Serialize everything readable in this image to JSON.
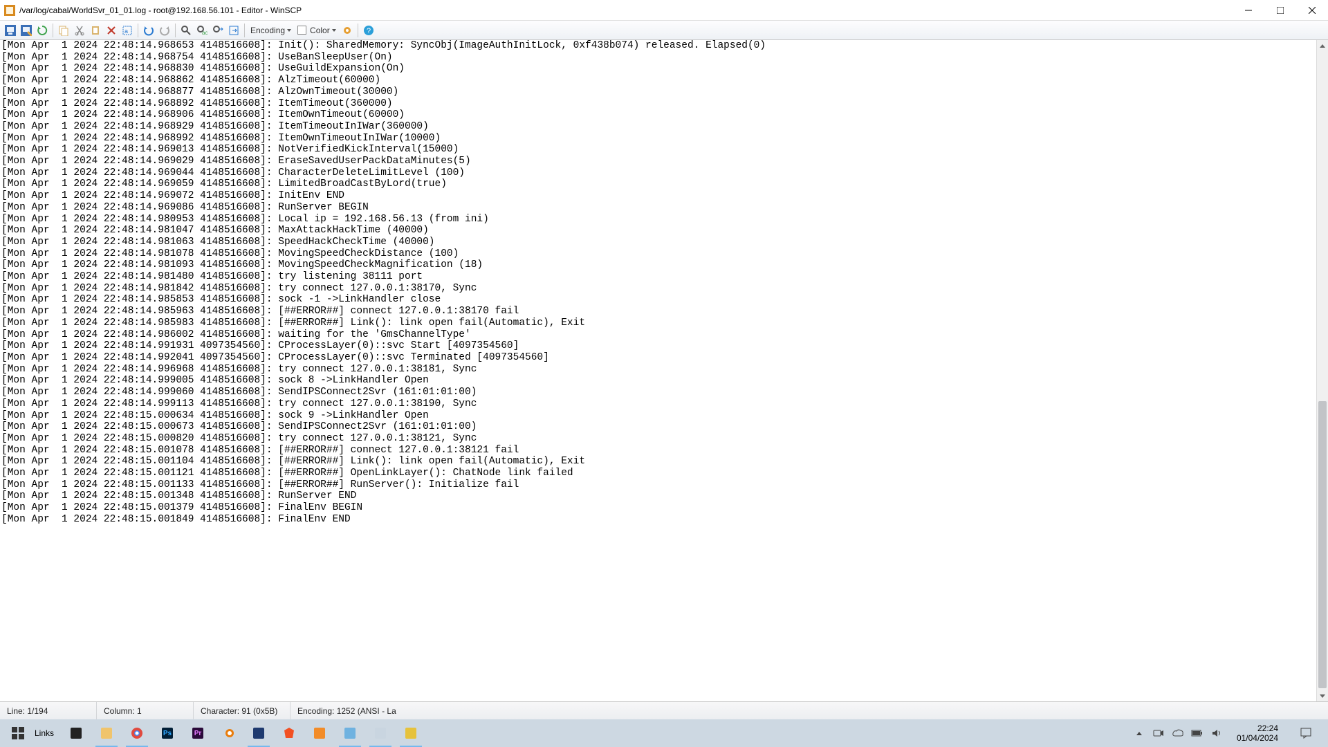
{
  "window": {
    "title": "/var/log/cabal/WorldSvr_01_01.log - root@192.168.56.101 - Editor - WinSCP"
  },
  "toolbar": {
    "encoding_label": "Encoding",
    "color_label": "Color"
  },
  "status": {
    "line": "Line: 1/194",
    "column": "Column: 1",
    "character": "Character: 91 (0x5B)",
    "encoding": "Encoding: 1252  (ANSI - La"
  },
  "log_lines": [
    "[Mon Apr  1 2024 22:48:14.968653 4148516608]: Init(): SharedMemory: SyncObj(ImageAuthInitLock, 0xf438b074) released. Elapsed(0)",
    "[Mon Apr  1 2024 22:48:14.968754 4148516608]: UseBanSleepUser(On)",
    "[Mon Apr  1 2024 22:48:14.968830 4148516608]: UseGuildExpansion(On)",
    "[Mon Apr  1 2024 22:48:14.968862 4148516608]: AlzTimeout(60000)",
    "[Mon Apr  1 2024 22:48:14.968877 4148516608]: AlzOwnTimeout(30000)",
    "[Mon Apr  1 2024 22:48:14.968892 4148516608]: ItemTimeout(360000)",
    "[Mon Apr  1 2024 22:48:14.968906 4148516608]: ItemOwnTimeout(60000)",
    "[Mon Apr  1 2024 22:48:14.968929 4148516608]: ItemTimeoutInIWar(360000)",
    "[Mon Apr  1 2024 22:48:14.968992 4148516608]: ItemOwnTimeoutInIWar(10000)",
    "[Mon Apr  1 2024 22:48:14.969013 4148516608]: NotVerifiedKickInterval(15000)",
    "[Mon Apr  1 2024 22:48:14.969029 4148516608]: EraseSavedUserPackDataMinutes(5)",
    "[Mon Apr  1 2024 22:48:14.969044 4148516608]: CharacterDeleteLimitLevel (100)",
    "[Mon Apr  1 2024 22:48:14.969059 4148516608]: LimitedBroadCastByLord(true)",
    "[Mon Apr  1 2024 22:48:14.969072 4148516608]: InitEnv END",
    "[Mon Apr  1 2024 22:48:14.969086 4148516608]: RunServer BEGIN",
    "[Mon Apr  1 2024 22:48:14.980953 4148516608]: Local ip = 192.168.56.13 (from ini)",
    "[Mon Apr  1 2024 22:48:14.981047 4148516608]: MaxAttackHackTime (40000)",
    "[Mon Apr  1 2024 22:48:14.981063 4148516608]: SpeedHackCheckTime (40000)",
    "[Mon Apr  1 2024 22:48:14.981078 4148516608]: MovingSpeedCheckDistance (100)",
    "[Mon Apr  1 2024 22:48:14.981093 4148516608]: MovingSpeedCheckMagnification (18)",
    "[Mon Apr  1 2024 22:48:14.981480 4148516608]: try listening 38111 port",
    "[Mon Apr  1 2024 22:48:14.981842 4148516608]: try connect 127.0.0.1:38170, Sync",
    "[Mon Apr  1 2024 22:48:14.985853 4148516608]: sock -1 ->LinkHandler close",
    "[Mon Apr  1 2024 22:48:14.985963 4148516608]: [##ERROR##] connect 127.0.0.1:38170 fail",
    "[Mon Apr  1 2024 22:48:14.985983 4148516608]: [##ERROR##] Link(): link open fail(Automatic), Exit",
    "[Mon Apr  1 2024 22:48:14.986002 4148516608]: waiting for the 'GmsChannelType'",
    "[Mon Apr  1 2024 22:48:14.991931 4097354560]: CProcessLayer(0)::svc Start [4097354560]",
    "[Mon Apr  1 2024 22:48:14.992041 4097354560]: CProcessLayer(0)::svc Terminated [4097354560]",
    "[Mon Apr  1 2024 22:48:14.996968 4148516608]: try connect 127.0.0.1:38181, Sync",
    "[Mon Apr  1 2024 22:48:14.999005 4148516608]: sock 8 ->LinkHandler Open",
    "[Mon Apr  1 2024 22:48:14.999060 4148516608]: SendIPSConnect2Svr (161:01:01:00)",
    "[Mon Apr  1 2024 22:48:14.999113 4148516608]: try connect 127.0.0.1:38190, Sync",
    "[Mon Apr  1 2024 22:48:15.000634 4148516608]: sock 9 ->LinkHandler Open",
    "[Mon Apr  1 2024 22:48:15.000673 4148516608]: SendIPSConnect2Svr (161:01:01:00)",
    "[Mon Apr  1 2024 22:48:15.000820 4148516608]: try connect 127.0.0.1:38121, Sync",
    "[Mon Apr  1 2024 22:48:15.001078 4148516608]: [##ERROR##] connect 127.0.0.1:38121 fail",
    "[Mon Apr  1 2024 22:48:15.001104 4148516608]: [##ERROR##] Link(): link open fail(Automatic), Exit",
    "[Mon Apr  1 2024 22:48:15.001121 4148516608]: [##ERROR##] OpenLinkLayer(): ChatNode link failed",
    "[Mon Apr  1 2024 22:48:15.001133 4148516608]: [##ERROR##] RunServer(): Initialize fail",
    "[Mon Apr  1 2024 22:48:15.001348 4148516608]: RunServer END",
    "[Mon Apr  1 2024 22:48:15.001379 4148516608]: FinalEnv BEGIN",
    "[Mon Apr  1 2024 22:48:15.001849 4148516608]: FinalEnv END"
  ],
  "taskbar": {
    "links_label": "Links"
  },
  "tray": {
    "time": "22:24",
    "date": "01/04/2024"
  },
  "icons": {
    "app": "#d88a1f",
    "floppy": "#3a6fb7",
    "floppy_as": "#3a6fb7",
    "reload": "#3fa34d",
    "copy": "#d9b36c",
    "cut": "#888",
    "paste": "#d9b36c",
    "delete": "#c0392b",
    "selectall": "#2b7bd1",
    "undo": "#2b7bd1",
    "redo": "#aaa",
    "find": "#555",
    "replace": "#555",
    "findnext": "#555",
    "goto": "#555",
    "gear": "#e69f33",
    "help": "#2b9fd9",
    "start": "#0078d7",
    "store": "#222",
    "explorer": "#f0c46c",
    "chrome": "#e04a3f",
    "ps": "#001e36",
    "pr": "#2a0a3a",
    "blender": "#e87d0d",
    "vbox": "#1e3a6f",
    "brave": "#f25022",
    "xampp": "#f28c28",
    "winscp": "#6fb2e0",
    "putty": "#c9d5e0",
    "comp": "#e6c23c"
  }
}
